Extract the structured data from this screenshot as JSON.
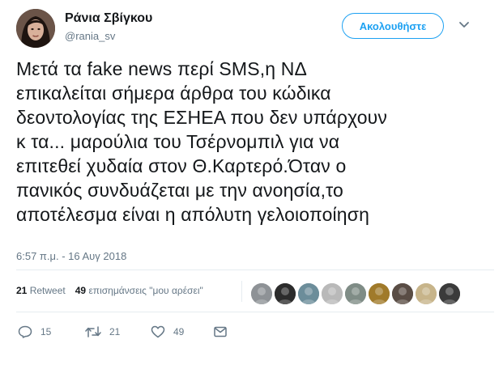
{
  "user": {
    "display_name": "Ράνια Σβίγκου",
    "handle": "@rania_sv",
    "follow_label": "Ακολουθήστε"
  },
  "tweet": {
    "text_lines": [
      "Μετά τα fake news περί SMS,η ΝΔ",
      "επικαλείται σήμερα άρθρα του κώδικα",
      "δεοντολογίας της ΕΣΗΕΑ που δεν υπάρχουν",
      "κ τα... μαρούλια του Τσέρνομπιλ για να",
      "επιτεθεί χυδαία στον Θ.Καρτερό.Όταν ο",
      "πανικός συνδυάζεται με την ανοησία,το",
      "αποτέλεσμα είναι η απόλυτη γελοιοποίηση"
    ],
    "timestamp": "6:57 π.μ. - 16 Αυγ 2018"
  },
  "stats": {
    "retweets_count": "21",
    "retweets_label": "Retweet",
    "likes_count": "49",
    "likes_label": "επισημάνσεις \"μου αρέσει\""
  },
  "likers": [
    {
      "name": "liker-avatar-1",
      "color": "#8e9296"
    },
    {
      "name": "liker-avatar-2",
      "color": "#2c2c2c"
    },
    {
      "name": "liker-avatar-3",
      "color": "#6c8d9a"
    },
    {
      "name": "liker-avatar-4",
      "color": "#b9b9b9"
    },
    {
      "name": "liker-avatar-5",
      "color": "#7f8c86"
    },
    {
      "name": "liker-avatar-6",
      "color": "#a07a2a"
    },
    {
      "name": "liker-avatar-7",
      "color": "#5a4d45"
    },
    {
      "name": "liker-avatar-8",
      "color": "#c7b48a"
    },
    {
      "name": "liker-avatar-9",
      "color": "#3b3b3b"
    }
  ],
  "actions": {
    "reply_count": "15",
    "retweet_count": "21",
    "like_count": "49"
  },
  "colors": {
    "accent": "#1da1f2",
    "text": "#14171a",
    "muted": "#657786",
    "divider": "#e6ecf0"
  }
}
